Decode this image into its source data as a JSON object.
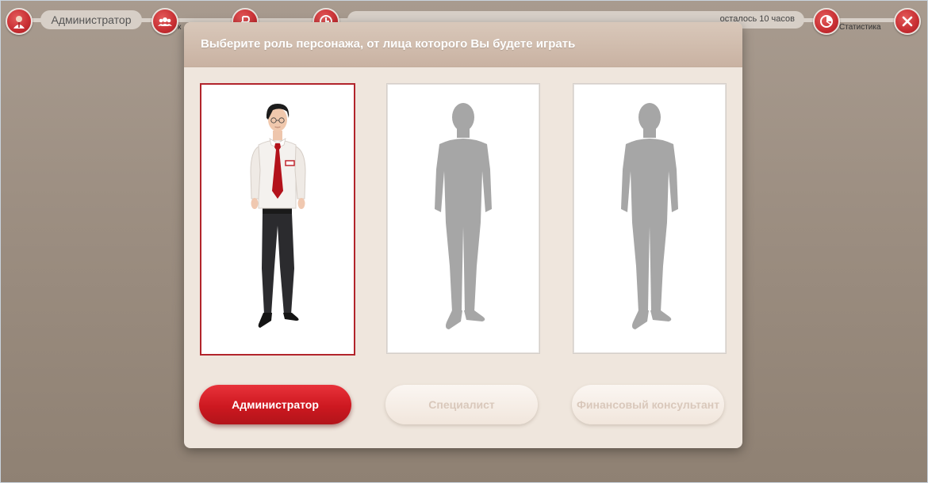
{
  "topbar": {
    "player_name": "Администратор",
    "partial_label": "к",
    "time_left": "осталось 10 часов",
    "statistics_label": "Статистика"
  },
  "modal": {
    "title": "Выберите роль персонажа, от лица которого Вы будете играть",
    "roles": [
      {
        "label": "Администратор",
        "selected": true
      },
      {
        "label": "Специалист",
        "selected": false
      },
      {
        "label": "Финансовый консультант",
        "selected": false
      }
    ]
  },
  "colors": {
    "accent": "#cd1820",
    "modal_bg": "#efe6dd",
    "page_bg": "#9c8e81"
  }
}
